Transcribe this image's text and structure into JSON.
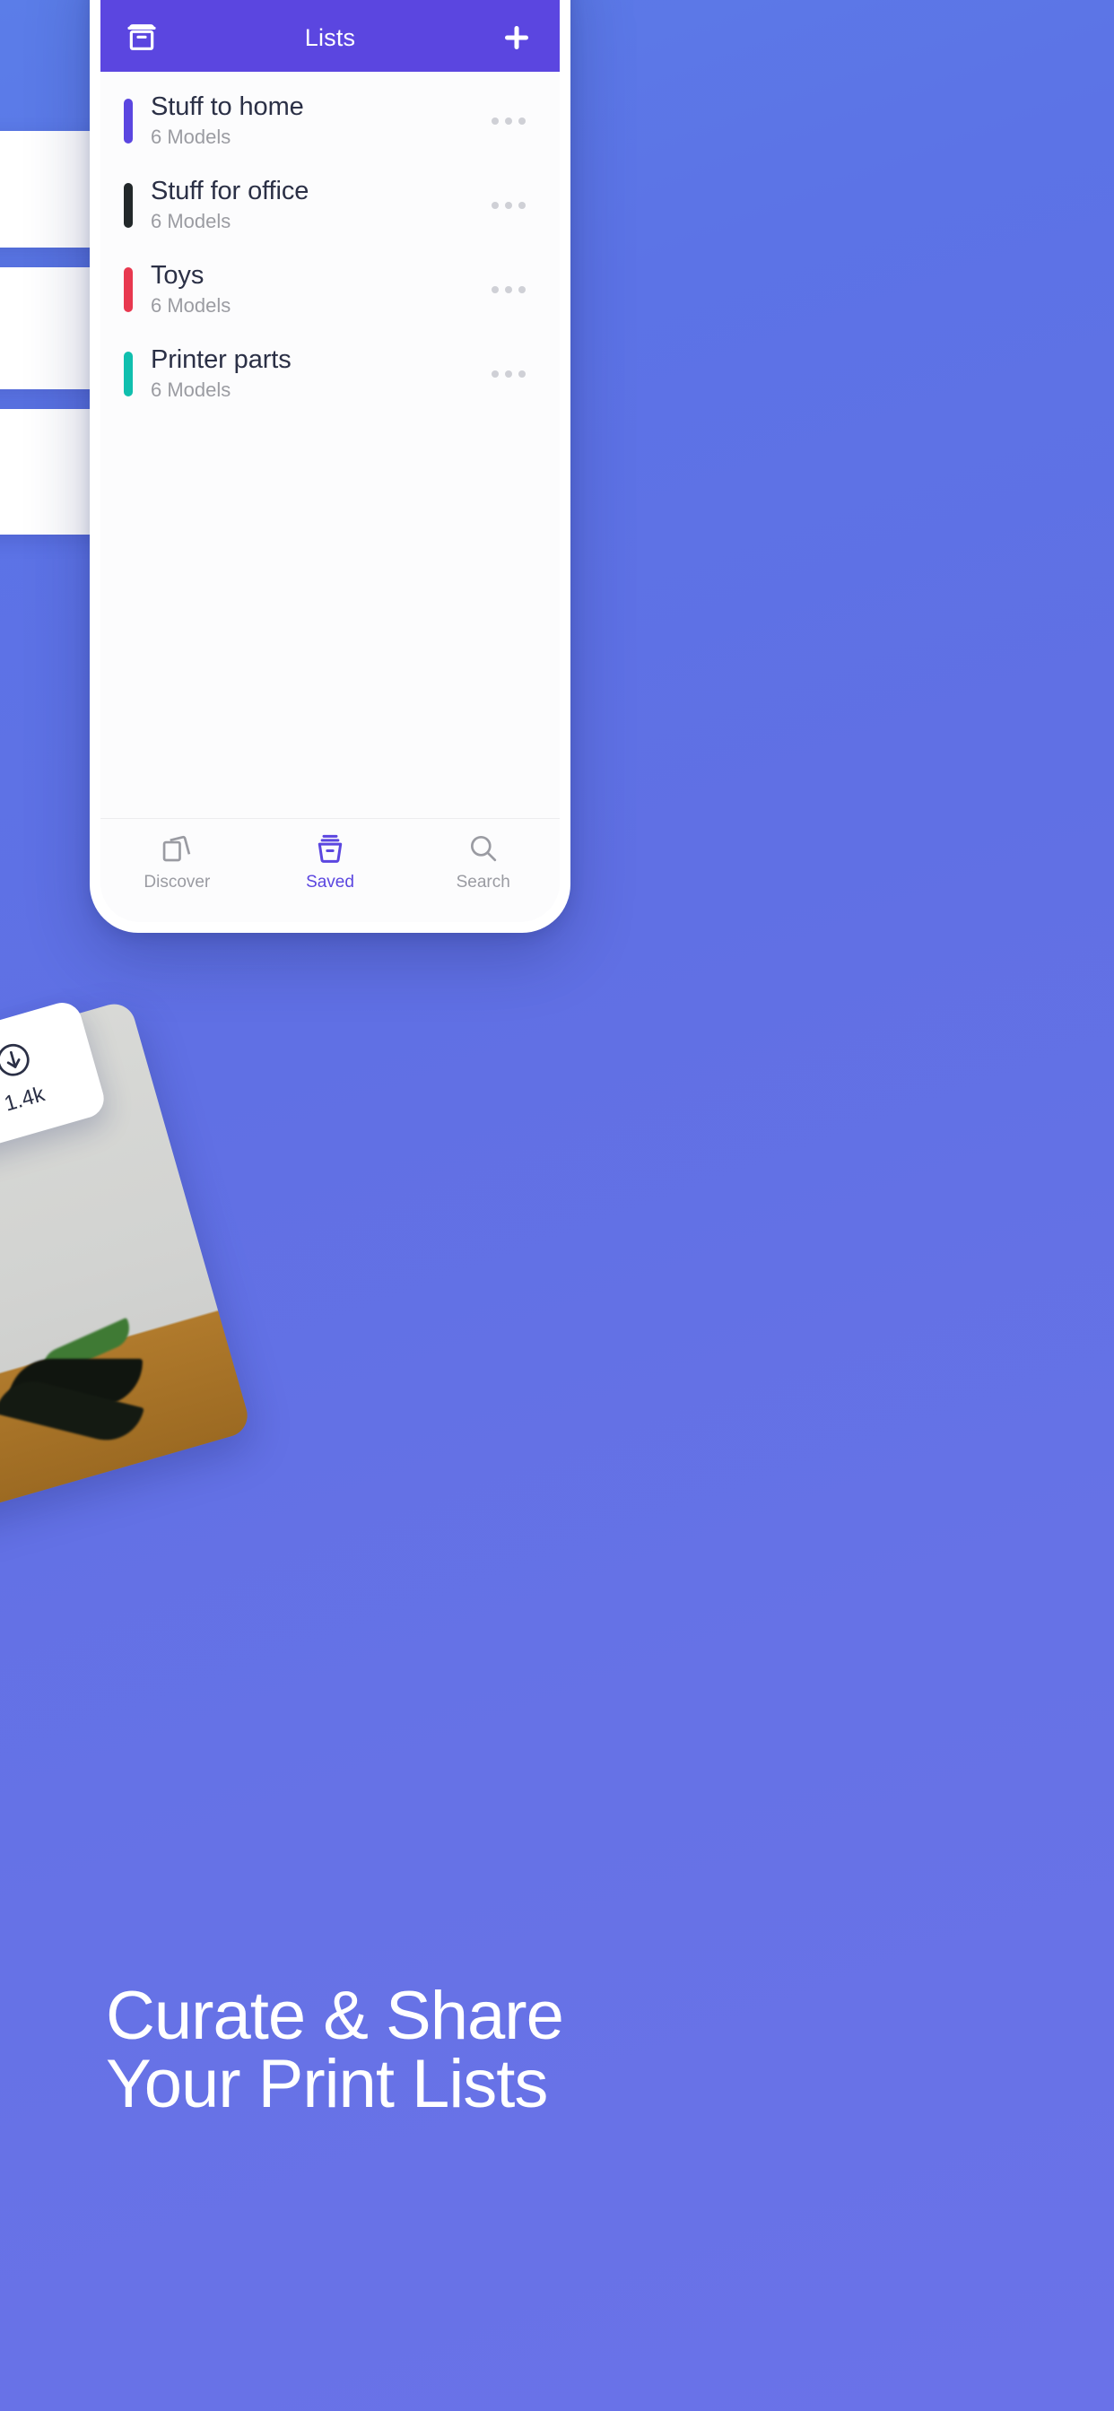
{
  "theme": {
    "background_gradient_start": "#5b7de8",
    "background_gradient_end": "#6a72e8",
    "accent_purple": "#5b46e0",
    "title_text_color": "#2b3046",
    "subtitle_text_color": "#9b9ca2",
    "inactive_nav_color": "#9a9ba2"
  },
  "appbar": {
    "leading_icon": "archive-icon",
    "title": "Lists",
    "action_icon": "plus-icon",
    "action_label": "+"
  },
  "lists": [
    {
      "title": "Stuff to home",
      "subtitle": "6 Models",
      "color": "#5b46e0",
      "menu_icon": "overflow-dots-icon"
    },
    {
      "title": "Stuff for office",
      "subtitle": "6 Models",
      "color": "#22282a",
      "menu_icon": "overflow-dots-icon"
    },
    {
      "title": "Toys",
      "subtitle": "6 Models",
      "color": "#e8384f",
      "menu_icon": "overflow-dots-icon"
    },
    {
      "title": "Printer parts",
      "subtitle": "6 Models",
      "color": "#10bfae",
      "menu_icon": "overflow-dots-icon"
    }
  ],
  "bottom_nav": [
    {
      "label": "Discover",
      "icon": "cards-stack-icon",
      "active": false
    },
    {
      "label": "Saved",
      "icon": "archive-icon",
      "active": true
    },
    {
      "label": "Search",
      "icon": "magnifier-icon",
      "active": false
    }
  ],
  "download_badge": {
    "icon": "download-circle-icon",
    "count": "1.4k"
  },
  "marketing": {
    "headline": "Curate & Share\nYour Print Lists"
  }
}
